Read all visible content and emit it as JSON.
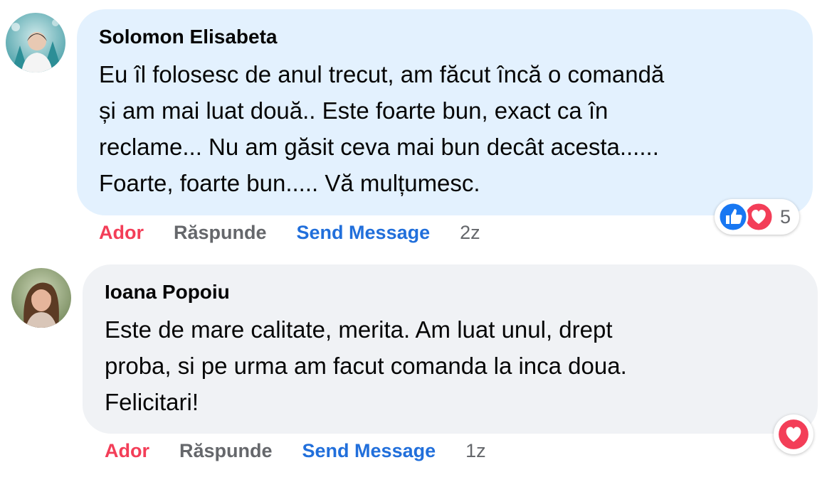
{
  "comments": [
    {
      "author": "Solomon Elisabeta",
      "lines": [
        "Eu îl folosesc de anul trecut, am făcut încă o comandă",
        "și am mai luat două.. Este foarte bun, exact ca în",
        "reclame... Nu am găsit ceva mai bun decât acesta......",
        "Foarte, foarte bun..... Vă mulțumesc."
      ],
      "bubble_color": "#e3f1fe",
      "like_label": "Ador",
      "reply_label": "Răspunde",
      "send_label": "Send Message",
      "time": "2z",
      "reactions": [
        "like-icon",
        "love-icon"
      ],
      "reaction_count": "5"
    },
    {
      "author": "Ioana Popoiu",
      "lines": [
        "Este de mare calitate, merita. Am luat unul, drept",
        "proba, si pe urma am facut comanda la inca doua.",
        "Felicitari!"
      ],
      "bubble_color": "#f0f2f5",
      "like_label": "Ador",
      "reply_label": "Răspunde",
      "send_label": "Send Message",
      "time": "1z",
      "reactions": [
        "love-icon"
      ]
    }
  ],
  "colors": {
    "like_active": "#f33e58",
    "link": "#216fdb",
    "muted": "#65676b",
    "like_blue": "#1877f2",
    "love_red": "#f33e58"
  }
}
